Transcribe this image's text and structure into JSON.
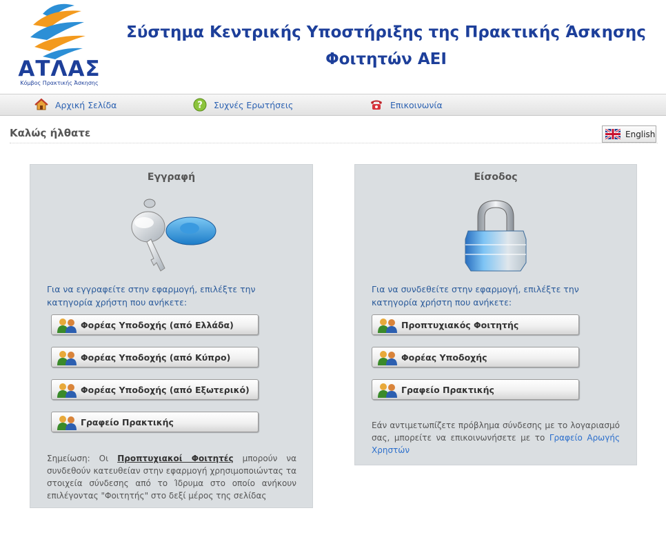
{
  "header": {
    "logo_text": "ΑΤΛΑΣ",
    "logo_subtitle": "Κόμβος Πρακτικής Άσκησης",
    "title_line1": "Σύστημα Κεντρικής Υποστήριξης της Πρακτικής Άσκησης",
    "title_line2": "Φοιτητών ΑΕΙ"
  },
  "nav": {
    "home": "Αρχική Σελίδα",
    "faq": "Συχνές Ερωτήσεις",
    "contact": "Επικοινωνία"
  },
  "welcome": "Καλώς ήλθατε",
  "language_button": "English",
  "register": {
    "title": "Εγγραφή",
    "instruction": "Για να εγγραφείτε στην εφαρμογή, επιλέξτε την κατηγορία χρήστη που ανήκετε:",
    "buttons": [
      "Φορέας Υποδοχής (από Ελλάδα)",
      "Φορέας Υποδοχής (από Κύπρο)",
      "Φορέας Υποδοχής (από Εξωτερικό)",
      "Γραφείο Πρακτικής"
    ],
    "note_prefix": "Σημείωση: Οι",
    "note_link": "Προπτυχιακοί Φοιτητές",
    "note_suffix": "μπορούν να συνδεθούν κατευθείαν στην εφαρμογή χρησιμοποιώντας τα στοιχεία σύνδεσης από το Ίδρυμα στο οποίο ανήκουν επιλέγοντας \"Φοιτητής\" στο δεξί μέρος της σελίδας"
  },
  "login": {
    "title": "Είσοδος",
    "instruction": "Για να συνδεθείτε στην εφαρμογή, επιλέξτε την κατηγορία χρήστη που ανήκετε:",
    "buttons": [
      "Προπτυχιακός Φοιτητής",
      "Φορέας Υποδοχής",
      "Γραφείο Πρακτικής"
    ],
    "help_text": "Εάν αντιμετωπίζετε πρόβλημα σύνδεσης με το λογαριασμό σας, μπορείτε να επικοινωνήσετε με το",
    "help_link": "Γραφείο Αρωγής Χρηστών"
  },
  "colors": {
    "brand_blue": "#1d3f9a",
    "link_blue": "#2c62b2",
    "panel_bg": "#dadee1"
  }
}
